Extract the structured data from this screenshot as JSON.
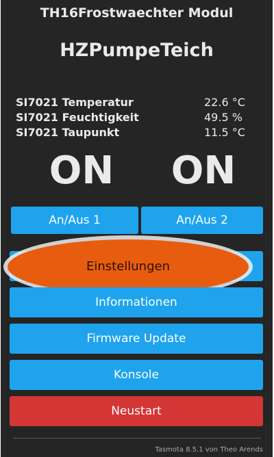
{
  "header": {
    "module_title": "TH16Frostwaechter Modul",
    "device_name": "HZPumpeTeich"
  },
  "sensors": [
    {
      "label": "SI7021 Temperatur",
      "value": "22.6 °C"
    },
    {
      "label": "SI7021 Feuchtigkeit",
      "value": "49.5 %"
    },
    {
      "label": "SI7021 Taupunkt",
      "value": "11.5 °C"
    }
  ],
  "power_states": [
    "ON",
    "ON"
  ],
  "toggles": {
    "toggle1_label": "An/Aus 1",
    "toggle2_label": "An/Aus 2"
  },
  "menu": {
    "settings_label": "Einstellungen",
    "information_label": "Informationen",
    "firmware_label": "Firmware Update",
    "console_label": "Konsole",
    "restart_label": "Neustart"
  },
  "footer": {
    "text": "Tasmota 8.5.1 von Theo Arends"
  },
  "colors": {
    "background": "#252525",
    "button": "#1fa3ec",
    "restart_button": "#d43535",
    "highlight": "#e85c10"
  }
}
